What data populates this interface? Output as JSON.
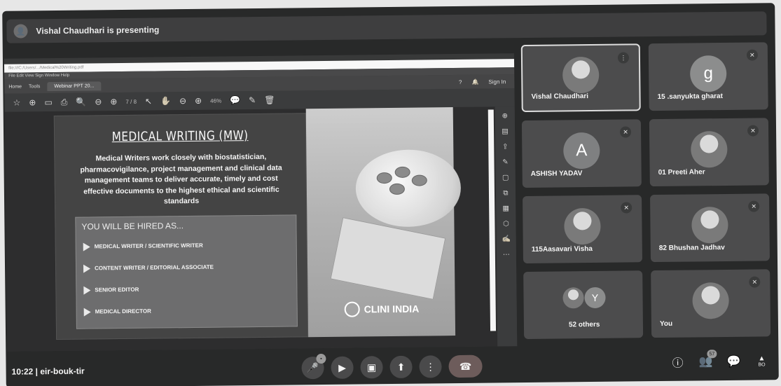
{
  "banner": {
    "presenting_text": "Vishal Chaudhari is presenting"
  },
  "viewer": {
    "url": "file:///C:/Users/.../Medical%20Writing.pdf",
    "menu": "File  Edit  View  Sign  Window  Help",
    "home_tab": "Home",
    "tools_tab": "Tools",
    "doc_tab": "Webinar PPT 20...",
    "sign_in": "Sign In",
    "page_indicator": "7 / 8",
    "zoom": "46%"
  },
  "slide": {
    "title": "MEDICAL WRITING (MW)",
    "body": "Medical Writers work closely with biostatistician, pharmacovigilance, project management and clinical data management teams to deliver accurate, timely and cost effective documents to the highest ethical and scientific standards",
    "hired_heading": "YOU WILL BE HIRED AS...",
    "roles": [
      "MEDICAL WRITER / SCIENTIFIC WRITER",
      "CONTENT WRITER / EDITORIAL ASSOCIATE",
      "SENIOR EDITOR",
      "MEDICAL DIRECTOR"
    ],
    "brand": "CLINI INDIA"
  },
  "participants": [
    {
      "name": "Vishal Chaudhari",
      "initial": "",
      "active": true
    },
    {
      "name": "15 .sanyukta gharat",
      "initial": "g",
      "active": false
    },
    {
      "name": "ASHISH YADAV",
      "initial": "A",
      "active": false
    },
    {
      "name": "01 Preeti Aher",
      "initial": "",
      "active": false
    },
    {
      "name": "115Aasavari Visha",
      "initial": "",
      "active": false
    },
    {
      "name": "82 Bhushan Jadhav",
      "initial": "",
      "active": false
    },
    {
      "name": "52 others",
      "initial": "Y",
      "active": false
    },
    {
      "name": "You",
      "initial": "",
      "active": false
    }
  ],
  "bottom": {
    "meeting_info": "10:22 | eir-bouk-tir",
    "mic_badge": "",
    "people_badge": "57",
    "activities_label": "BO"
  }
}
